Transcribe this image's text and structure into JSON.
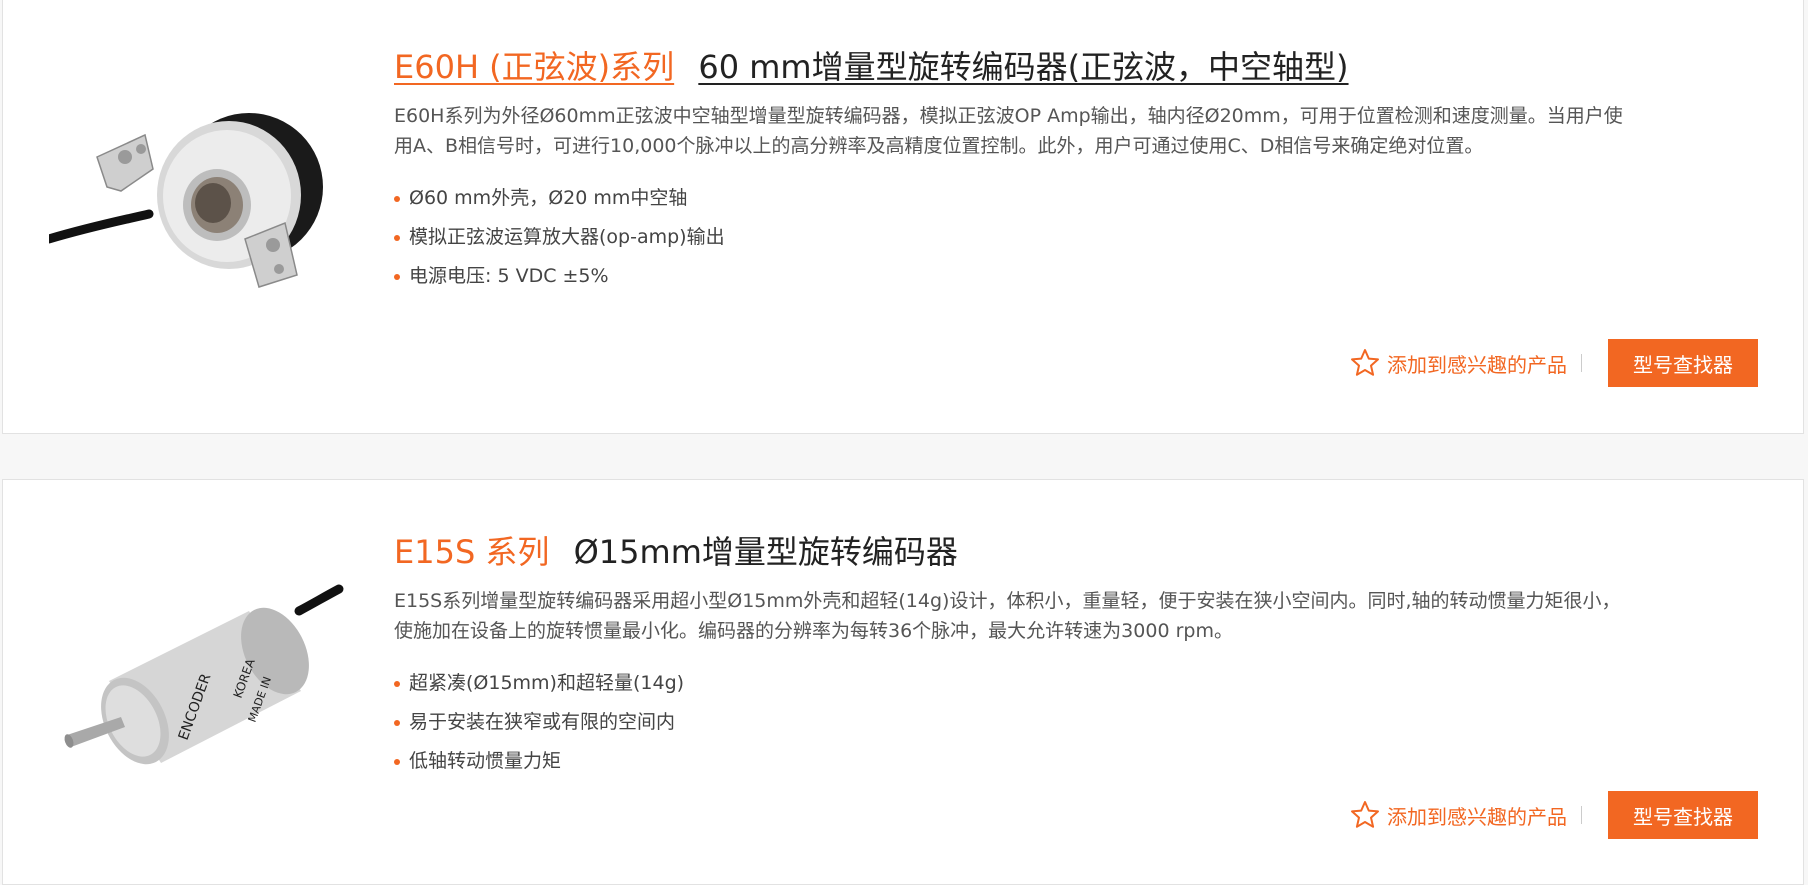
{
  "products": [
    {
      "series": "E60H (正弦波)系列",
      "subtitle": "60 mm增量型旋转编码器(正弦波，中空轴型)",
      "description": "E60H系列为外径Ø60mm正弦波中空轴型增量型旋转编码器，模拟正弦波OP Amp输出，轴内径Ø20mm，可用于位置检测和速度测量。当用户使用A、B相信号时，可进行10,000个脉冲以上的高分辨率及高精度位置控制。此外，用户可通过使用C、D相信号来确定绝对位置。",
      "bullets": [
        "Ø60 mm外壳，Ø20 mm中空轴",
        "模拟正弦波运算放大器(op-amp)输出",
        "电源电压: 5 VDC ±5%"
      ],
      "favorite_label": "添加到感兴趣的产品",
      "finder_label": "型号查找器"
    },
    {
      "series": "E15S 系列",
      "subtitle": "Ø15mm增量型旋转编码器",
      "description": "E15S系列增量型旋转编码器采用超小型Ø15mm外壳和超轻(14g)设计，体积小，重量轻，便于安装在狭小空间内。同时,轴的转动惯量力矩很小，使施加在设备上的旋转惯量最小化。编码器的分辨率为每转36个脉冲，最大允许转速为3000 rpm。",
      "bullets": [
        "超紧凑(Ø15mm)和超轻量(14g)",
        "易于安装在狭窄或有限的空间内",
        "低轴转动惯量力矩"
      ],
      "favorite_label": "添加到感兴趣的产品",
      "finder_label": "型号查找器",
      "label_text": [
        "ENCODER",
        "KOREA",
        "MADE IN"
      ]
    }
  ],
  "colors": {
    "accent": "#f26722",
    "text": "#333333",
    "muted": "#555555"
  },
  "icons": {
    "favorite": "star-outline-icon"
  }
}
